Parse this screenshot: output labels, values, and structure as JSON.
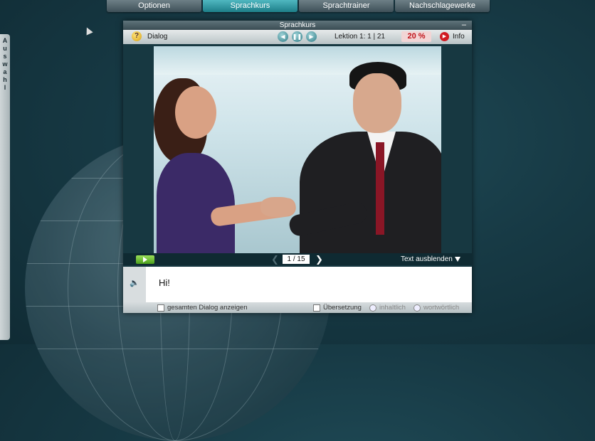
{
  "top_menu": {
    "items": [
      "Optionen",
      "Sprachkurs",
      "Sprachtrainer",
      "Nachschlagewerke"
    ],
    "active": "Sprachkurs"
  },
  "side_tab": {
    "label": "A\nu\ns\nw\na\nh\nl"
  },
  "window": {
    "title": "Sprachkurs",
    "minimize": "–"
  },
  "toolbar": {
    "help_icon": "?",
    "section": "Dialog",
    "lesson": "Lektion 1:   1 | 21",
    "progress": "20 %",
    "info_label": "Info"
  },
  "playbar": {
    "page": "1  /  15",
    "hide_text": "Text ausblenden"
  },
  "dialog": {
    "line": "Hi!"
  },
  "bottom": {
    "show_full_dialog": "gesamten Dialog anzeigen",
    "translation": "Übersetzung",
    "inhaltlich": "inhaltlich",
    "wortwoertlich": "wortwörtlich"
  },
  "colors": {
    "accent": "#1d7e88",
    "progress": "#c0141b",
    "play": "#6cc22e"
  },
  "icons": [
    "help-icon",
    "prev-icon",
    "pause-icon",
    "next-icon",
    "info-icon",
    "play-icon",
    "speaker-icon"
  ]
}
